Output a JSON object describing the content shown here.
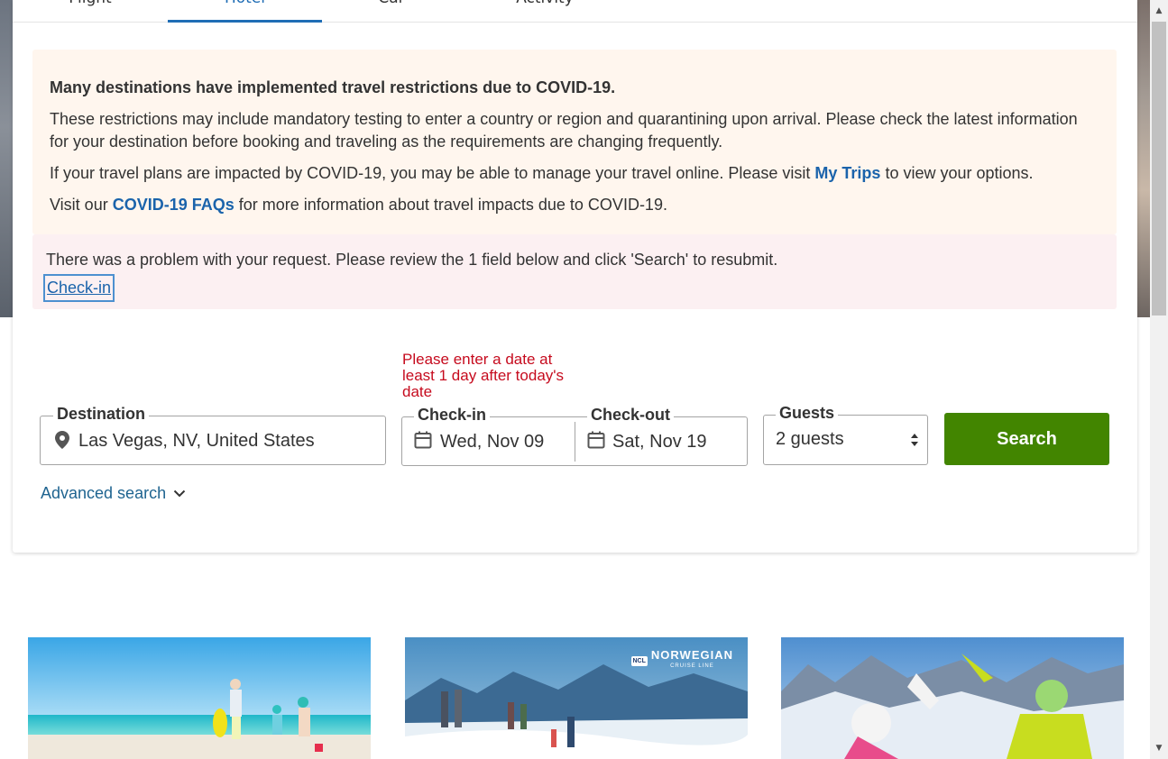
{
  "tabs": [
    {
      "label": "Flight",
      "active": false
    },
    {
      "label": "Hotel",
      "active": true
    },
    {
      "label": "Car",
      "active": false
    },
    {
      "label": "Activity",
      "active": false
    }
  ],
  "covid_notice": {
    "headline": "Many destinations have implemented travel restrictions due to COVID-19.",
    "para1": "These restrictions may include mandatory testing to enter a country or region and quarantining upon arrival. Please check the latest information for your destination before booking and traveling as the requirements are changing frequently.",
    "para2_before": "If your travel plans are impacted by COVID-19, you may be able to manage your travel online. Please visit ",
    "para2_link": "My Trips",
    "para2_after": " to view your options.",
    "para3_before": "Visit our ",
    "para3_link": "COVID-19 FAQs",
    "para3_after": " for more information about travel impacts due to COVID-19."
  },
  "error_notice": {
    "message": "There was a problem with your request. Please review the 1 field below and click 'Search' to resubmit.",
    "field_link": "Check-in"
  },
  "search_form": {
    "date_error": "Please enter a date at least 1 day after today's date",
    "destination": {
      "label": "Destination",
      "value": "Las Vegas, NV, United States",
      "icon": "map-pin-icon"
    },
    "checkin": {
      "label": "Check-in",
      "value": "Wed, Nov 09",
      "icon": "calendar-icon"
    },
    "checkout": {
      "label": "Check-out",
      "value": "Sat, Nov 19",
      "icon": "calendar-icon"
    },
    "guests": {
      "label": "Guests",
      "value": "2 guests"
    },
    "search_label": "Search",
    "advanced_label": "Advanced search"
  },
  "promos": [
    {
      "name": "beach-family"
    },
    {
      "name": "norwegian-cruise",
      "logo_badge": "NCL",
      "logo_text": "NORWEGIAN",
      "logo_sub": "CRUISE LINE"
    },
    {
      "name": "ski-highfive"
    }
  ],
  "colors": {
    "accent_blue": "#1f6db5",
    "link_blue": "#1a63ab",
    "error_red": "#c60b1e",
    "search_green": "#428500",
    "covid_bg": "#fff6ee",
    "error_bg": "#fcf0f2"
  }
}
